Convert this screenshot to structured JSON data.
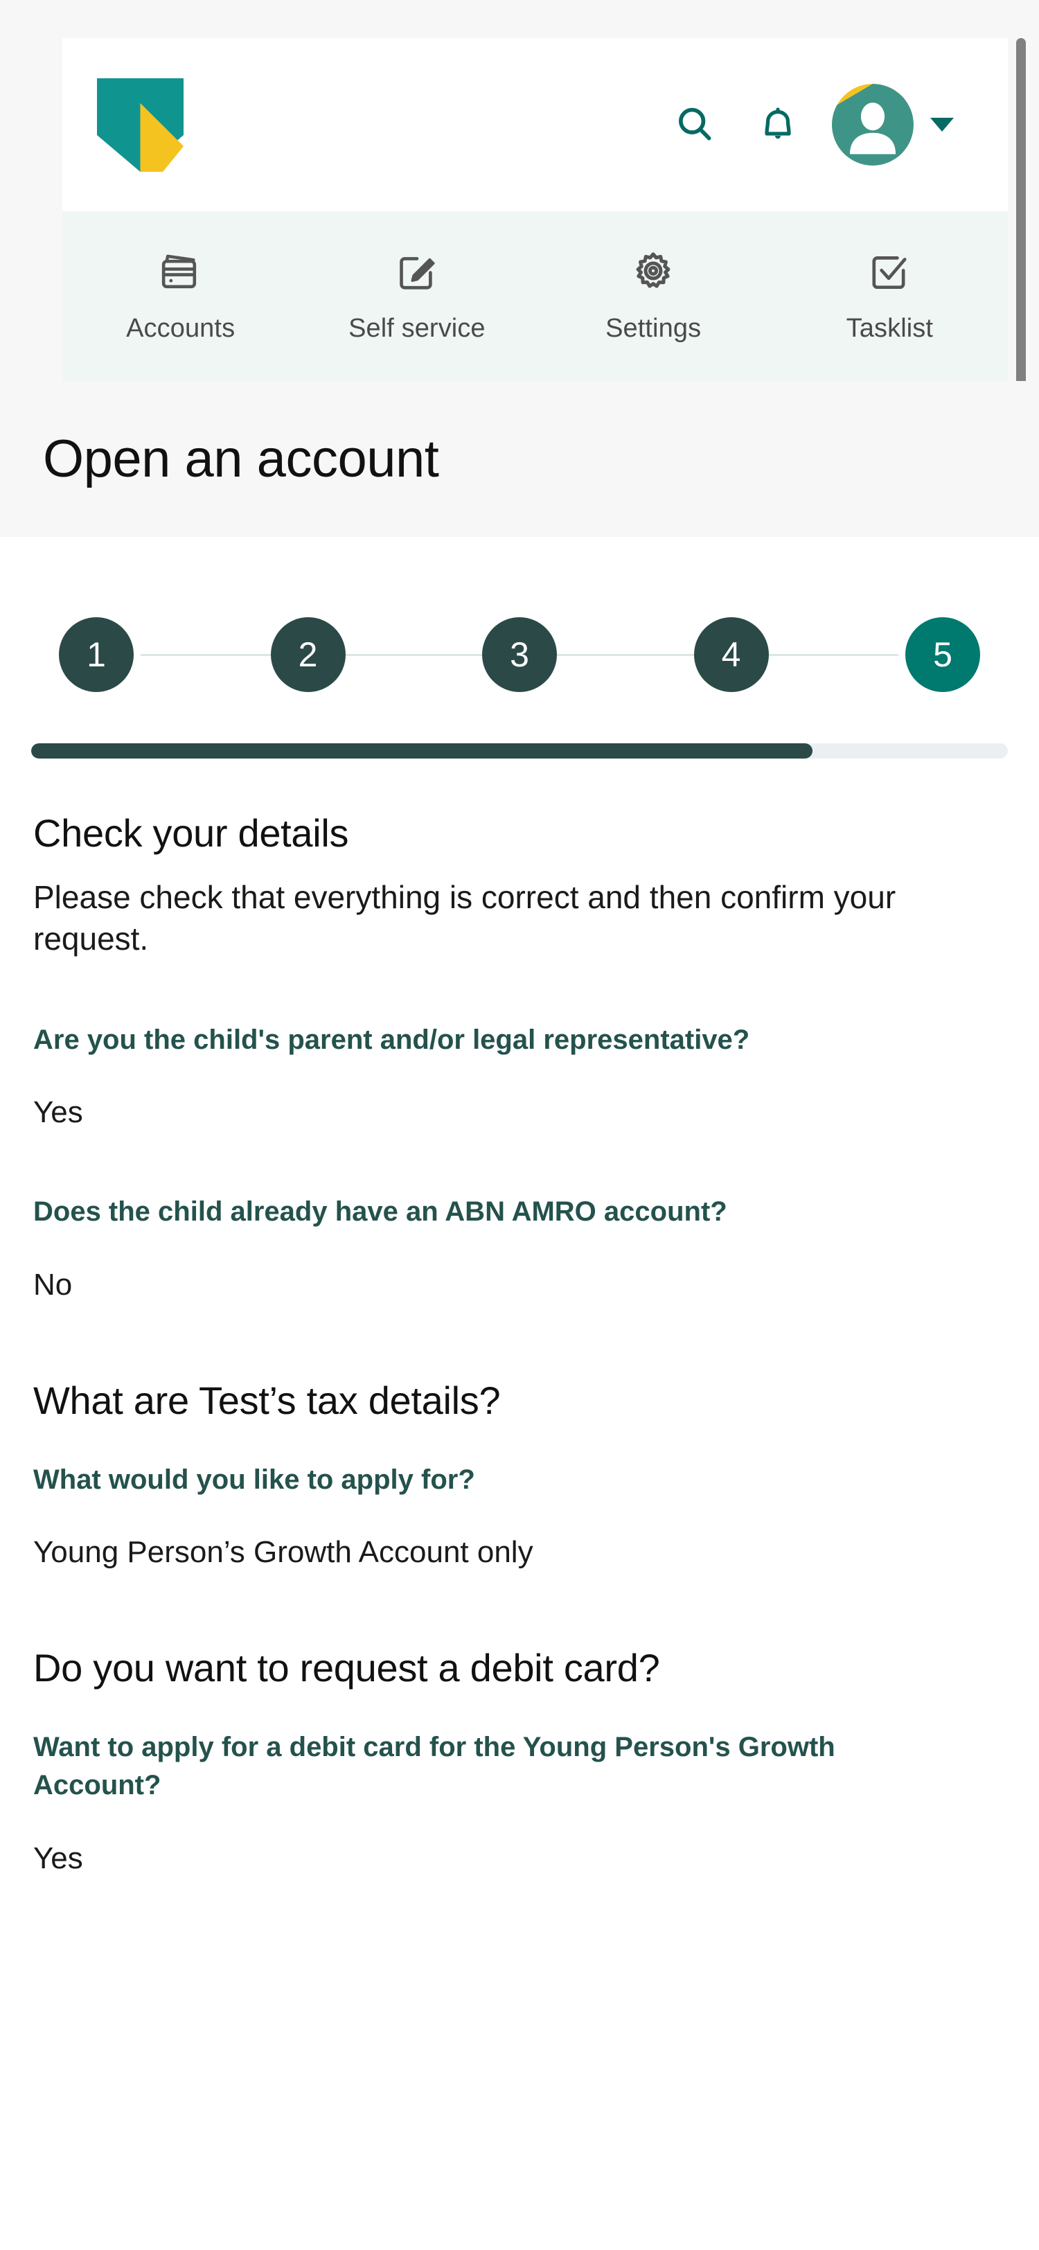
{
  "app": {
    "brand": "ABN AMRO",
    "logo_icon": "abnamro-shield-logo",
    "logo_colors": {
      "shield": "#109490",
      "accent": "#f5c320"
    }
  },
  "header": {
    "search_icon": "search-icon",
    "notifications_icon": "bell-icon",
    "avatar_icon": "user-avatar-icon",
    "profile_caret_icon": "chevron-down-icon",
    "accent_color": "#056A63"
  },
  "nav": {
    "tabs": [
      {
        "label": "Accounts",
        "icon": "wallet-card-icon"
      },
      {
        "label": "Self service",
        "icon": "edit-square-icon"
      },
      {
        "label": "Settings",
        "icon": "gear-icon"
      },
      {
        "label": "Tasklist",
        "icon": "checked-box-icon"
      }
    ]
  },
  "page": {
    "title": "Open an account"
  },
  "stepper": {
    "steps": [
      "1",
      "2",
      "3",
      "4",
      "5"
    ],
    "current_step": 5,
    "progress_percent": 80,
    "active_color": "#00796f",
    "done_color": "#2b4a47"
  },
  "main": {
    "heading": "Check your details",
    "subheading": "Please check that everything is correct and then confirm your request.",
    "items": [
      {
        "question": "Are you the child's parent and/or legal representative?",
        "answer": "Yes"
      },
      {
        "question": "Does the child already have an ABN AMRO account?",
        "answer": "No"
      }
    ],
    "groups": [
      {
        "heading": "What are Test’s tax details?",
        "items": [
          {
            "question": "What would you like to apply for?",
            "answer": "Young Person’s Growth Account only"
          }
        ]
      },
      {
        "heading": "Do you want to request a debit card?",
        "items": [
          {
            "question": "Want to apply for a debit card for the Young Person's Growth Account?",
            "answer": "Yes"
          }
        ]
      }
    ]
  }
}
